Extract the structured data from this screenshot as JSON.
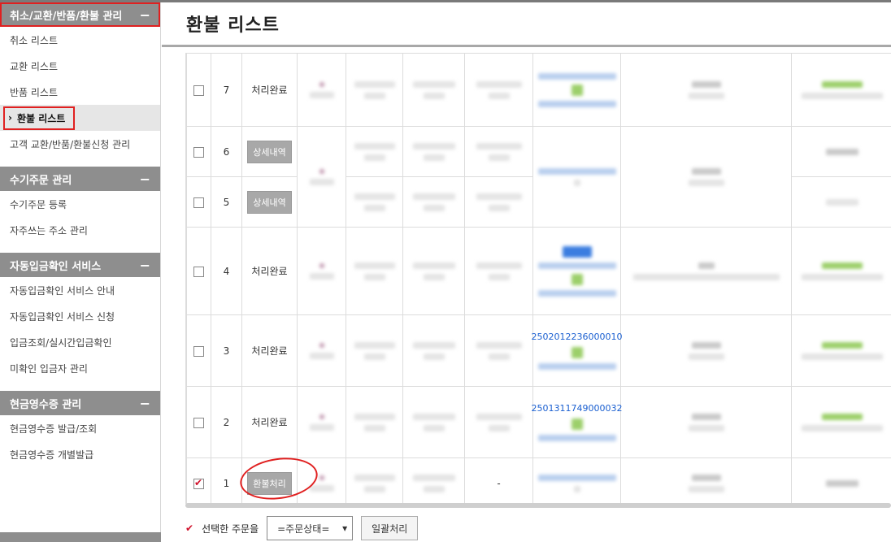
{
  "sidebar": {
    "sections": [
      {
        "title": "취소/교환/반품/환불 관리",
        "toggle": "−",
        "items": [
          "취소 리스트",
          "교환 리스트",
          "반품 리스트",
          "환불 리스트",
          "고객 교환/반품/환불신청 관리"
        ]
      },
      {
        "title": "수기주문 관리",
        "toggle": "−",
        "items": [
          "수기주문 등록",
          "자주쓰는 주소 관리"
        ]
      },
      {
        "title": "자동입금확인 서비스",
        "toggle": "−",
        "items": [
          "자동입금확인 서비스 안내",
          "자동입금확인 서비스 신청",
          "입금조회/실시간입금확인",
          "미확인 입금자 관리"
        ]
      },
      {
        "title": "현금영수증 관리",
        "toggle": "−",
        "items": [
          "현금영수증 발급/조회",
          "현금영수증 개별발급"
        ]
      }
    ],
    "active_item_prefix": "›"
  },
  "main": {
    "title": "환불 리스트"
  },
  "table": {
    "rows": [
      {
        "no": "7",
        "status": "처리완료",
        "status_type": "text",
        "checked": false
      },
      {
        "no": "6",
        "status": "상세내역",
        "status_type": "button",
        "checked": false
      },
      {
        "no": "5",
        "status": "상세내역",
        "status_type": "button",
        "checked": false
      },
      {
        "no": "4",
        "status": "처리완료",
        "status_type": "text",
        "checked": false
      },
      {
        "no": "3",
        "status": "처리완료",
        "status_type": "text",
        "checked": false
      },
      {
        "no": "2",
        "status": "처리완료",
        "status_type": "text",
        "checked": false
      },
      {
        "no": "1",
        "status": "환불처리",
        "status_type": "button",
        "checked": true
      }
    ],
    "partial_order_numbers": {
      "row3": "2502012236000010",
      "row2": "2501311749000032"
    },
    "row1_dash": "-"
  },
  "actions": {
    "check_label": "✔",
    "selected_label": "선택한 주문을",
    "select_value": "=주문상태=",
    "batch_button": "일괄처리"
  },
  "colors": {
    "accent_red": "#e02020",
    "section_bg": "#8e8e8e",
    "link_blue": "#1a5fd0",
    "check_red": "#d0102a"
  }
}
